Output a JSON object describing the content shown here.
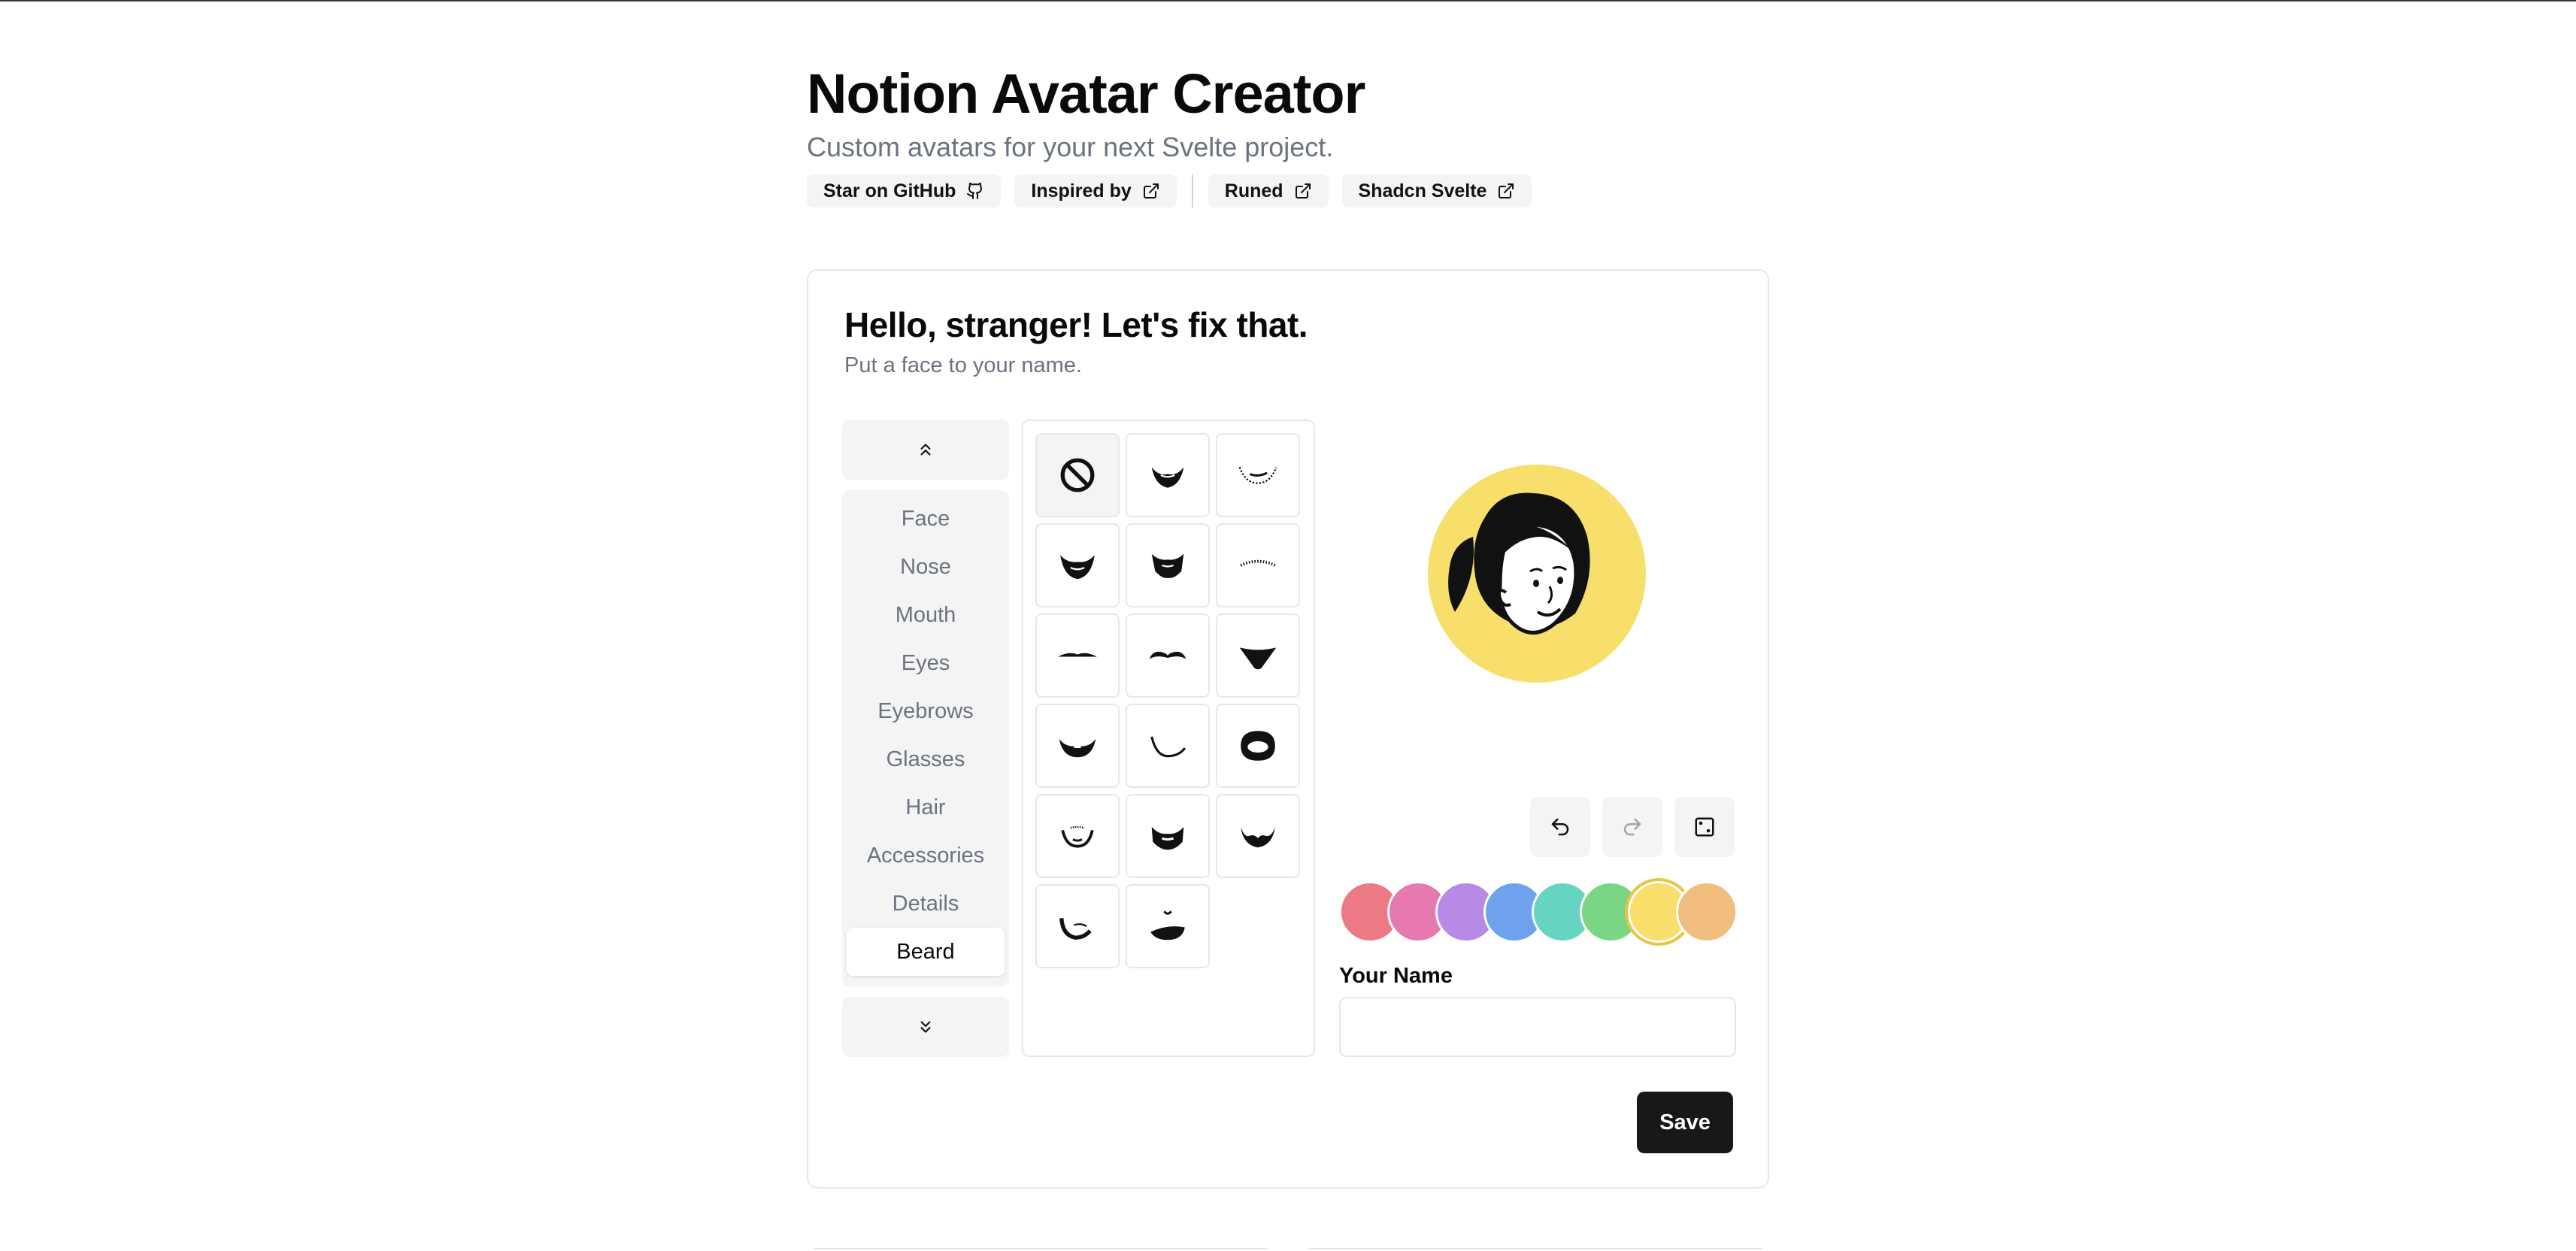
{
  "header": {
    "title": "Notion Avatar Creator",
    "subtitle": "Custom avatars for your next Svelte project.",
    "links": [
      {
        "label": "Star on GitHub",
        "icon": "github-icon"
      },
      {
        "label": "Inspired by",
        "icon": "external-link-icon"
      },
      {
        "label": "Runed",
        "icon": "external-link-icon"
      },
      {
        "label": "Shadcn Svelte",
        "icon": "external-link-icon"
      }
    ]
  },
  "card": {
    "title": "Hello, stranger! Let's fix that.",
    "description": "Put a face to your name."
  },
  "categories": {
    "items": [
      "Face",
      "Nose",
      "Mouth",
      "Eyes",
      "Eyebrows",
      "Glasses",
      "Hair",
      "Accessories",
      "Details",
      "Beard"
    ],
    "active": "Beard",
    "scroll_up_icon": "chevrons-up-icon",
    "scroll_down_icon": "chevrons-down-icon"
  },
  "options": {
    "count": 17,
    "selected_index": 0,
    "first_icon": "none-icon"
  },
  "toolbar": {
    "undo_icon": "undo-icon",
    "redo_icon": "redo-icon",
    "randomize_icon": "dice-icon"
  },
  "colors": {
    "swatches": [
      "#ec7a84",
      "#e579b0",
      "#b88ae8",
      "#6ea2ef",
      "#67d4c2",
      "#79d684",
      "#f8df6b",
      "#f2be7f"
    ],
    "selected": "#f8df6b"
  },
  "name_field": {
    "label": "Your Name",
    "value": "",
    "placeholder": ""
  },
  "save_label": "Save"
}
